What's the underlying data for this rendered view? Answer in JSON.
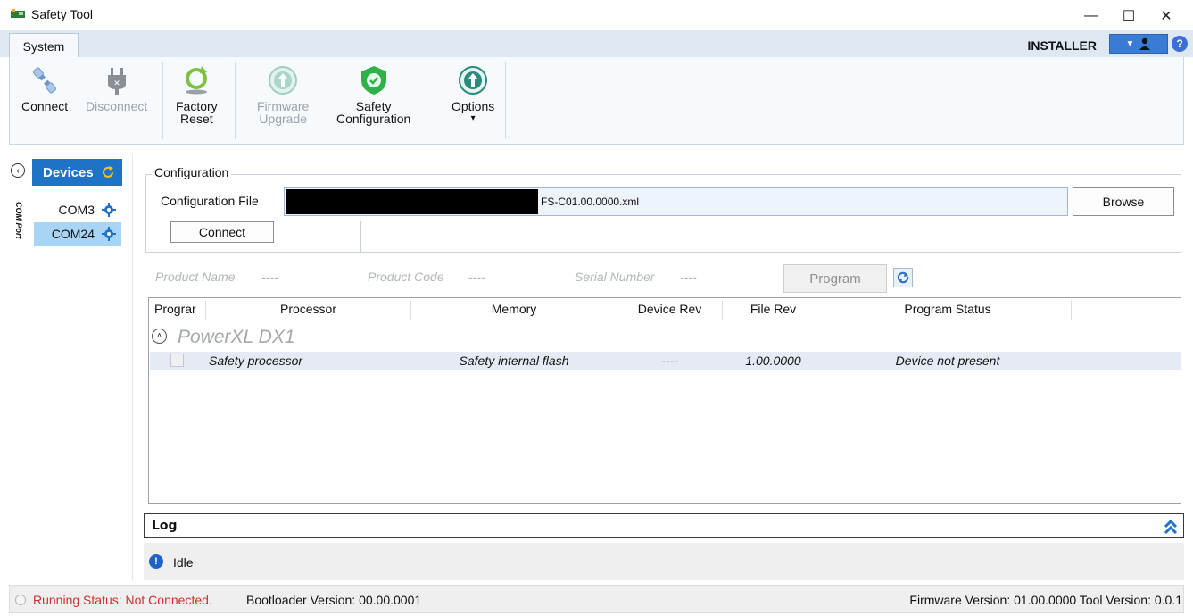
{
  "window": {
    "title": "Safety Tool",
    "minimize_glyph": "—",
    "maximize_glyph": "☐",
    "close_glyph": "✕"
  },
  "ribbon": {
    "tab": "System",
    "user_role": "INSTALLER",
    "help_glyph": "?",
    "buttons": {
      "connect": "Connect",
      "disconnect": "Disconnect",
      "factory_reset_1": "Factory",
      "factory_reset_2": "Reset",
      "firmware_upgrade_1": "Firmware",
      "firmware_upgrade_2": "Upgrade",
      "safety_config_1": "Safety",
      "safety_config_2": "Configuration",
      "options": "Options",
      "options_arrow": "▾"
    }
  },
  "devices": {
    "header": "Devices",
    "group_label": "COM Port",
    "items": [
      {
        "label": "COM3",
        "selected": false
      },
      {
        "label": "COM24",
        "selected": true
      }
    ]
  },
  "configuration": {
    "legend": "Configuration",
    "file_label": "Configuration File",
    "file_value": "FS-C01.00.0000.xml",
    "browse": "Browse",
    "connect": "Connect"
  },
  "product_info": {
    "name_label": "Product Name",
    "name_value": "----",
    "code_label": "Product Code",
    "code_value": "----",
    "serial_label": "Serial Number",
    "serial_value": "----",
    "program": "Program"
  },
  "grid": {
    "columns": [
      "Prograr",
      "Processor",
      "Memory",
      "Device Rev",
      "File Rev",
      "Program Status"
    ],
    "group": "PowerXL DX1",
    "rows": [
      {
        "processor": "Safety processor",
        "memory": "Safety internal flash",
        "device_rev": "----",
        "file_rev": "1.00.0000",
        "status": "Device not present",
        "checked": false
      }
    ]
  },
  "log": {
    "title": "Log",
    "message": "Idle",
    "info_glyph": "!"
  },
  "status_bar": {
    "running_status": "Running Status: Not Connected.",
    "bootloader": "Bootloader Version: 00.00.0001",
    "versions": "Firmware Version: 01.00.0000 Tool Version: 0.0.1"
  },
  "colors": {
    "accent": "#1e73c8",
    "ribbon": "#dde8f3",
    "error_text": "#d0312d",
    "green": "#3fae49",
    "teal": "#2a8a7c"
  }
}
